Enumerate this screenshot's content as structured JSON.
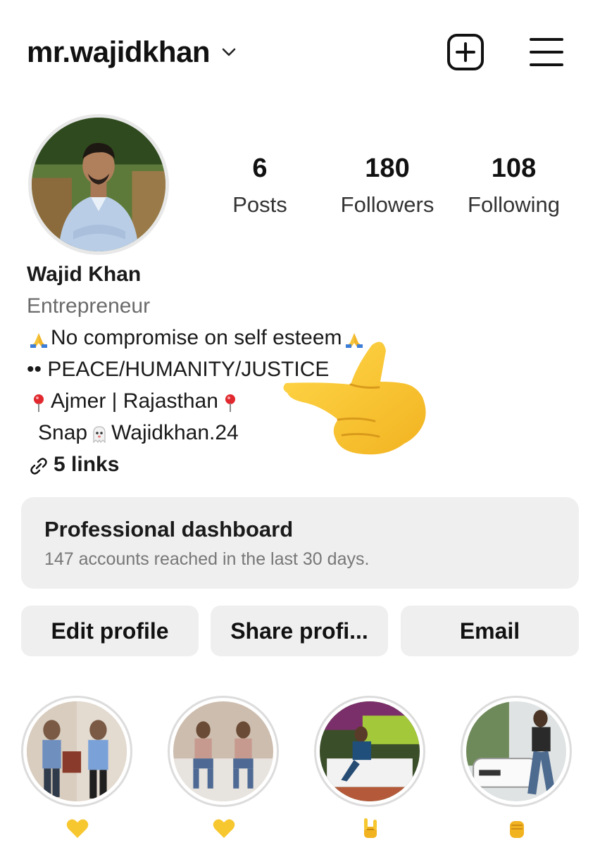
{
  "header": {
    "username": "mr.wajidkhan",
    "icons": [
      "chevron-down-icon",
      "add-post-icon",
      "menu-icon"
    ]
  },
  "stats": {
    "posts": {
      "value": "6",
      "label": "Posts"
    },
    "followers": {
      "value": "180",
      "label": "Followers"
    },
    "following": {
      "value": "108",
      "label": "Following"
    }
  },
  "bio": {
    "name": "Wajid Khan",
    "category": "Entrepreneur",
    "line1": "No compromise on self esteem",
    "line2": "•• PEACE/HUMANITY/JUSTICE",
    "line3": "Ajmer | Rajasthan",
    "line4_prefix": "Snap",
    "line4_handle": "Wajidkhan.24",
    "links": "5 links",
    "emojis": [
      "folded-hands",
      "round-pushpin",
      "ghost",
      "link-icon"
    ]
  },
  "dashboard": {
    "title": "Professional dashboard",
    "subtitle": "147 accounts reached in the last 30 days."
  },
  "buttons": {
    "edit": "Edit profile",
    "share": "Share profi...",
    "email": "Email"
  },
  "highlights": [
    {
      "emoji": "yellow-heart"
    },
    {
      "emoji": "yellow-heart"
    },
    {
      "emoji": "sign-of-the-horns"
    },
    {
      "emoji": "raised-fist"
    }
  ],
  "colors": {
    "text": "#111111",
    "muted": "#6b6b6b",
    "card": "#efefef",
    "emoji_yellow": "#f7c72f"
  }
}
